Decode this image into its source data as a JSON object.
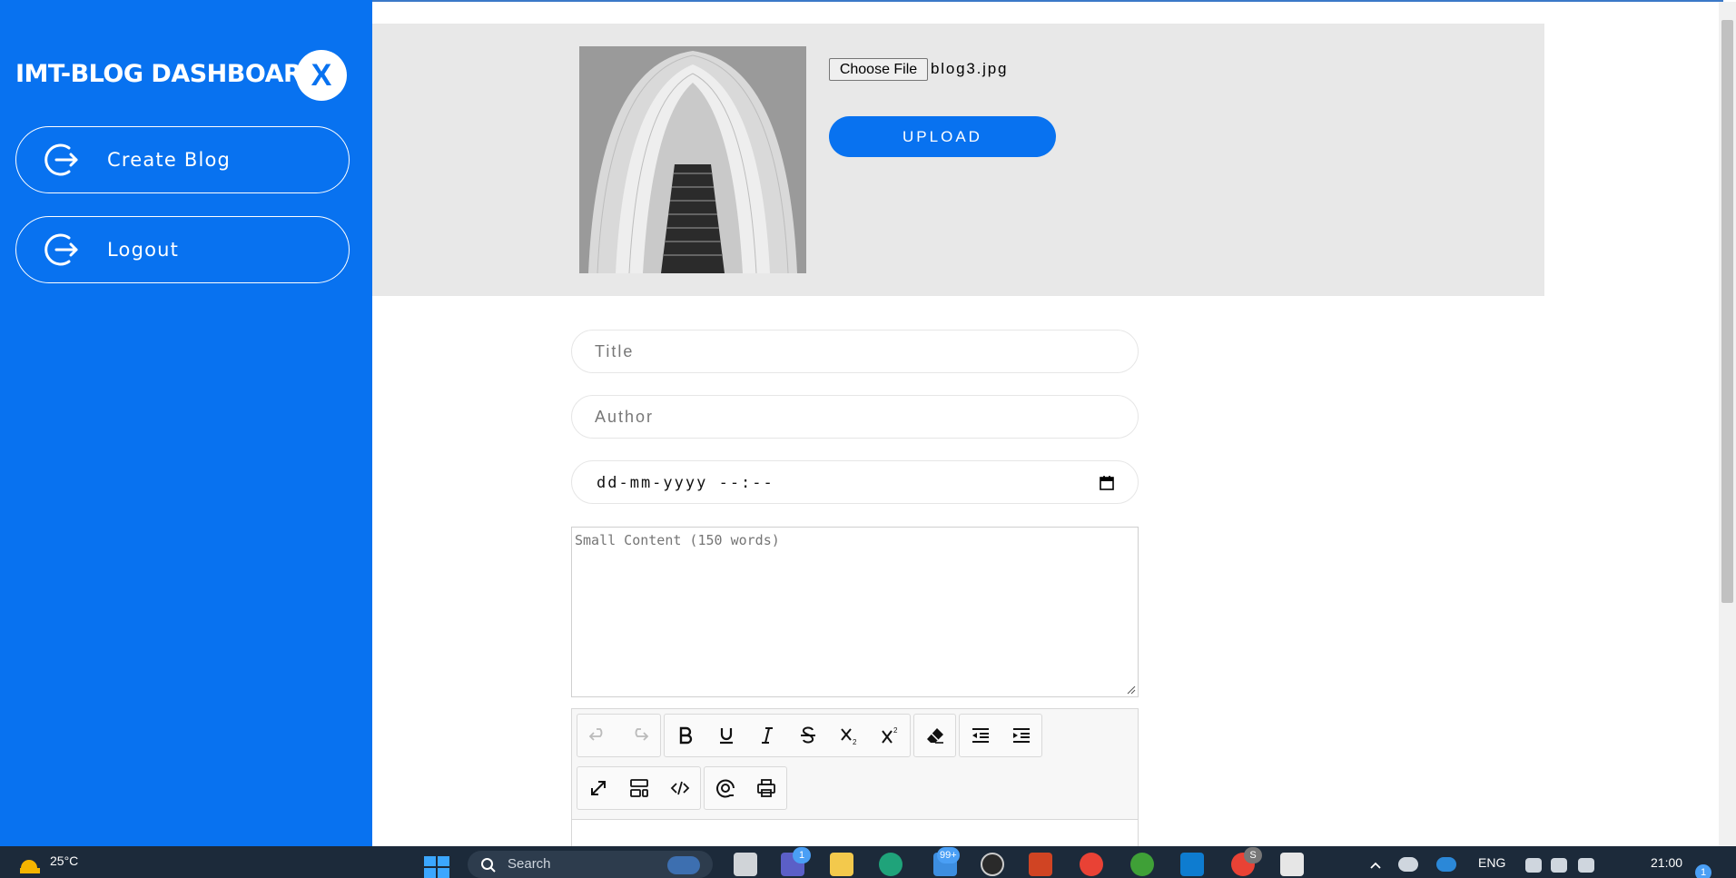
{
  "sidebar": {
    "brand": "IMT-BLOG DASHBOARD",
    "close_label": "X",
    "items": [
      {
        "label": "Create Blog",
        "icon": "logout-arrow-icon"
      },
      {
        "label": "Logout",
        "icon": "logout-arrow-icon"
      }
    ]
  },
  "upload": {
    "choose_file_label": "Choose File",
    "file_name": "blog3.jpg",
    "upload_label": "UPLOAD"
  },
  "form": {
    "title_placeholder": "Title",
    "author_placeholder": "Author",
    "datetime_value": "dd-mm-yyyy --:--",
    "small_content_placeholder": "Small Content (150 words)"
  },
  "taskbar": {
    "temperature": "25°C",
    "search_label": "Search",
    "teams_badge": "1",
    "mail_badge": "99+",
    "chrome_badge": "S",
    "language": "ENG",
    "time": "21:00",
    "notification_count": "1"
  },
  "colors": {
    "brand": "#0872f0",
    "panel_bg": "#e8e8e8",
    "taskbar": "#1c2a3a"
  }
}
